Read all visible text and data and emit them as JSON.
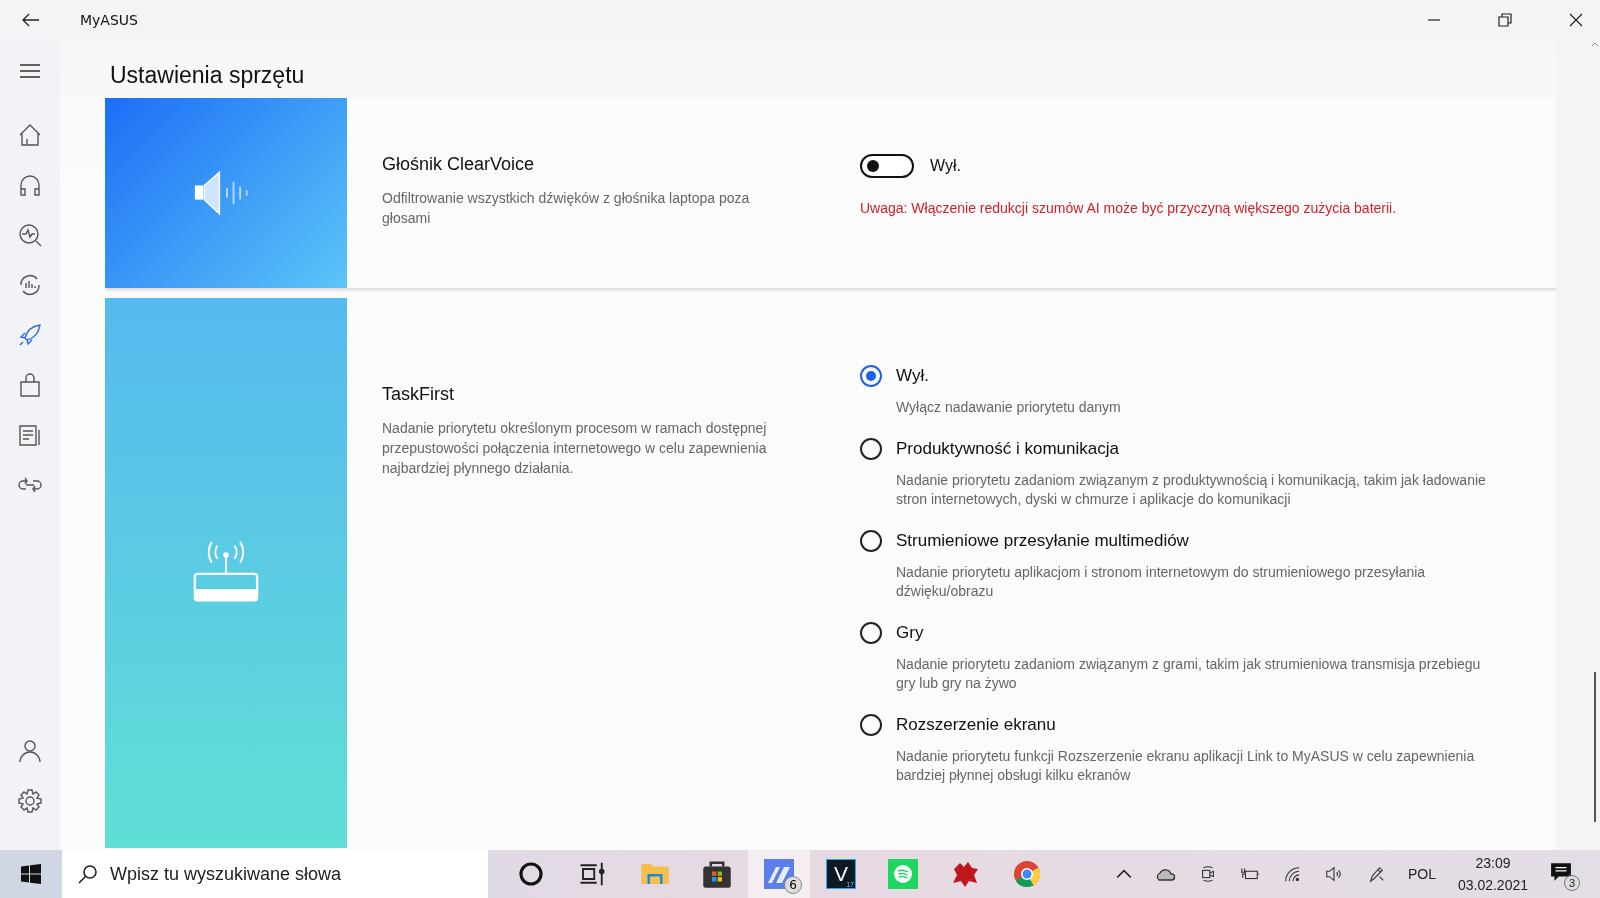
{
  "window": {
    "title": "MyASUS"
  },
  "sidebar": {
    "items": [
      {
        "kind": "home",
        "selected": false
      },
      {
        "kind": "headset",
        "selected": false
      },
      {
        "kind": "diagnosis",
        "selected": false
      },
      {
        "kind": "update",
        "selected": false
      },
      {
        "kind": "rocket",
        "selected": true
      },
      {
        "kind": "bag",
        "selected": false
      },
      {
        "kind": "news",
        "selected": false
      },
      {
        "kind": "link",
        "selected": false
      }
    ],
    "bottom_items": [
      {
        "kind": "user",
        "selected": false
      },
      {
        "kind": "settings",
        "selected": false
      }
    ]
  },
  "page": {
    "title": "Ustawienia sprzętu"
  },
  "sections": [
    {
      "kind": "toggle",
      "title": "Głośnik ClearVoice",
      "description": "Odfiltrowanie wszystkich dźwięków z głośnika laptopa poza głosami",
      "toggle": {
        "on": false,
        "label": "Wył."
      },
      "warning": "Uwaga: Włączenie redukcji szumów AI może być przyczyną większego zużycia baterii."
    },
    {
      "kind": "radio",
      "title": "TaskFirst",
      "description": "Nadanie priorytetu określonym procesom w ramach dostępnej przepustowości połączenia internetowego w celu zapewnienia najbardziej płynnego działania.",
      "options": [
        {
          "label": "Wył.",
          "description": "Wyłącz nadawanie priorytetu danym",
          "selected": true
        },
        {
          "label": "Produktywność i komunikacja",
          "description": "Nadanie priorytetu zadaniom związanym z produktywnością i komunikacją, takim jak ładowanie stron internetowych, dyski w chmurze i aplikacje do komunikacji",
          "selected": false
        },
        {
          "label": "Strumieniowe przesyłanie multimediów",
          "description": "Nadanie priorytetu aplikacjom i stronom internetowym do strumieniowego przesyłania dźwięku/obrazu",
          "selected": false
        },
        {
          "label": "Gry",
          "description": "Nadanie priorytetu zadaniom związanym z grami, takim jak strumieniowa transmisja przebiegu gry lub gry na żywo",
          "selected": false
        },
        {
          "label": "Rozszerzenie ekranu",
          "description": "Nadanie priorytetu funkcji Rozszerzenie ekranu aplikacji Link to MyASUS w celu zapewnienia bardziej płynnej obsługi kilku ekranów",
          "selected": false
        }
      ]
    }
  ],
  "taskbar": {
    "search": {
      "placeholder": "Wpisz tu wyszukiwane słowa"
    },
    "apps": [
      {
        "kind": "cortana",
        "selected": false
      },
      {
        "kind": "taskview",
        "selected": false
      },
      {
        "kind": "explorer",
        "selected": false
      },
      {
        "kind": "store",
        "selected": false
      },
      {
        "kind": "myasus",
        "selected": true,
        "badge": "6"
      },
      {
        "kind": "vegas",
        "selected": false,
        "label": "V",
        "sub": "17"
      },
      {
        "kind": "spotify",
        "selected": false
      },
      {
        "kind": "puzzle",
        "selected": false
      },
      {
        "kind": "chrome",
        "selected": false
      }
    ],
    "tray": {
      "language": "POL",
      "time": "23:09",
      "date": "03.02.2021",
      "notifications": "3"
    }
  }
}
